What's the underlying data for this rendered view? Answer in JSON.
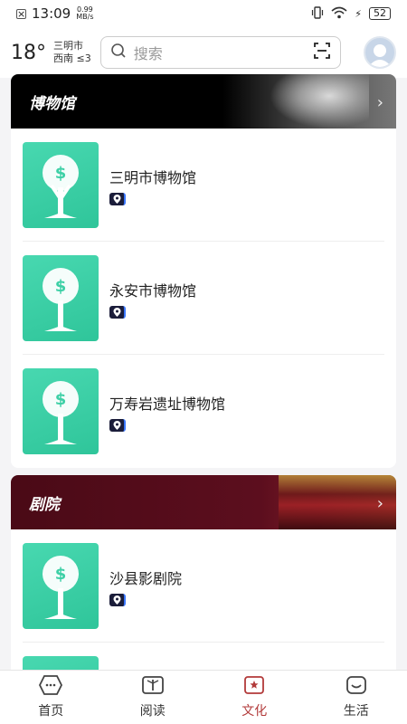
{
  "status_bar": {
    "time": "13:09",
    "net_speed_value": "0.99",
    "net_speed_unit": "MB/s",
    "battery": "52"
  },
  "header": {
    "temperature": "18°",
    "city": "三明市",
    "wind": "西南 ≤3",
    "search_placeholder": "搜索"
  },
  "sections": {
    "museum": {
      "title": "博物馆",
      "items": [
        {
          "name": "三明市博物馆"
        },
        {
          "name": "永安市博物馆"
        },
        {
          "name": "万寿岩遗址博物馆"
        }
      ]
    },
    "theatre": {
      "title": "剧院",
      "items": [
        {
          "name": "沙县影剧院"
        }
      ]
    }
  },
  "tabbar": {
    "tabs": [
      {
        "label": "首页",
        "icon": "home-icon"
      },
      {
        "label": "阅读",
        "icon": "book-icon"
      },
      {
        "label": "文化",
        "icon": "culture-icon"
      },
      {
        "label": "生活",
        "icon": "life-icon"
      }
    ],
    "active": "文化"
  },
  "colors": {
    "accent": "#b23a3a",
    "thumb_green": "#3dd0a6",
    "theatre_red": "#5c0e1e"
  }
}
